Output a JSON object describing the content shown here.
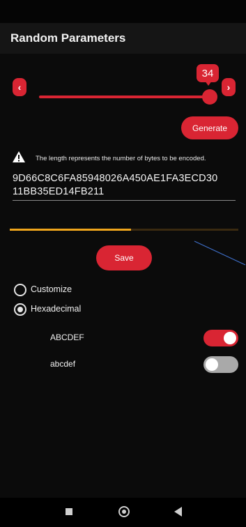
{
  "app": {
    "title": "Random Parameters"
  },
  "slider": {
    "value": "34",
    "decrement_icon": "chevron-left-icon",
    "increment_icon": "chevron-right-icon",
    "accent": "#d92533"
  },
  "actions": {
    "generate_label": "Generate",
    "save_label": "Save"
  },
  "info": {
    "icon": "warning-icon",
    "text": "The length represents the number of bytes to be encoded."
  },
  "output": {
    "lines": [
      "9D66C8C6FA85948026A450AE1FA3ECD30",
      "11BB35ED14FB211"
    ]
  },
  "progress": {
    "fraction": 0.53,
    "color": "#f0a61c"
  },
  "mode": {
    "options": [
      {
        "label": "Customize",
        "selected": false
      },
      {
        "label": "Hexadecimal",
        "selected": true
      }
    ]
  },
  "case_options": [
    {
      "label": "ABCDEF",
      "enabled": true,
      "on_color": "#d92533"
    },
    {
      "label": "abcdef",
      "enabled": false,
      "off_color": "#a9a9a9"
    }
  ],
  "nav": {
    "recents_icon": "square-icon",
    "home_icon": "home-circle-icon",
    "back_icon": "back-triangle-icon"
  }
}
